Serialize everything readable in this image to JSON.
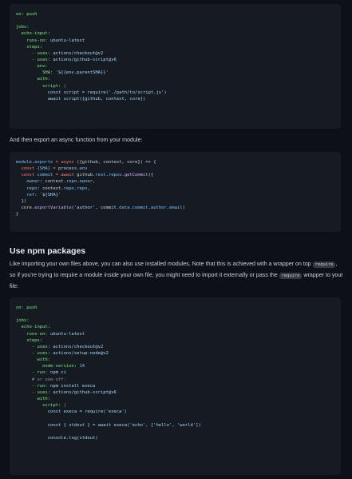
{
  "block1": [
    [
      [
        "on: push",
        "k"
      ]
    ],
    [],
    [
      [
        "jobs:",
        "k"
      ]
    ],
    [
      [
        "  echo-input:",
        "k"
      ]
    ],
    [
      [
        "    runs-on: ",
        "k"
      ],
      [
        "ubuntu-latest",
        "s"
      ]
    ],
    [
      [
        "    steps:",
        "k"
      ]
    ],
    [
      [
        "      - uses: ",
        "k"
      ],
      [
        "actions/checkout@v2",
        "s"
      ]
    ],
    [
      [
        "      - uses: ",
        "k"
      ],
      [
        "actions/github-script@v6",
        "s"
      ]
    ],
    [
      [
        "        env:",
        "k"
      ]
    ],
    [
      [
        "          SHA: ",
        "k"
      ],
      [
        "'${{env.parentSHA}}'",
        "s"
      ]
    ],
    [
      [
        "        with:",
        "k"
      ]
    ],
    [
      [
        "          script: ",
        "k"
      ],
      [
        "|",
        "r"
      ]
    ],
    [
      [
        "            const script = require('./path/to/script.js')",
        "s"
      ]
    ],
    [
      [
        "            await script({github, context, core})",
        "s"
      ]
    ]
  ],
  "para1": "And then export an async function from your module:",
  "block2": [
    [
      [
        "module",
        "v"
      ],
      [
        ".",
        "p"
      ],
      [
        "exports",
        "v"
      ],
      [
        " = ",
        "r"
      ],
      [
        "async",
        "r"
      ],
      [
        " ({github, context, core}) => {",
        "p"
      ]
    ],
    [
      [
        "  ",
        "p"
      ],
      [
        "const",
        "r"
      ],
      [
        " {SHA} ",
        "v"
      ],
      [
        "= ",
        "r"
      ],
      [
        "process",
        "p"
      ],
      [
        ".",
        "p"
      ],
      [
        "env",
        "v"
      ]
    ],
    [
      [
        "  ",
        "p"
      ],
      [
        "const",
        "r"
      ],
      [
        " commit ",
        "v"
      ],
      [
        "= ",
        "r"
      ],
      [
        "await",
        "r"
      ],
      [
        " github.",
        "p"
      ],
      [
        "rest",
        "v"
      ],
      [
        ".",
        "p"
      ],
      [
        "repos",
        "v"
      ],
      [
        ".",
        "p"
      ],
      [
        "getCommit",
        "f"
      ],
      [
        "({",
        "p"
      ]
    ],
    [
      [
        "    owner",
        "v"
      ],
      [
        ": context.",
        "p"
      ],
      [
        "repo",
        "v"
      ],
      [
        ".",
        "p"
      ],
      [
        "owner",
        "v"
      ],
      [
        ",",
        "p"
      ]
    ],
    [
      [
        "    repo",
        "v"
      ],
      [
        ": context.",
        "p"
      ],
      [
        "repo",
        "v"
      ],
      [
        ".",
        "p"
      ],
      [
        "repo",
        "v"
      ],
      [
        ",",
        "p"
      ]
    ],
    [
      [
        "    ref",
        "v"
      ],
      [
        ": ",
        "p"
      ],
      [
        "`${SHA}`",
        "s"
      ]
    ],
    [
      [
        "  })",
        "p"
      ]
    ],
    [
      [
        "  core.",
        "p"
      ],
      [
        "exportVariable",
        "f"
      ],
      [
        "(",
        "p"
      ],
      [
        "'author'",
        "s"
      ],
      [
        ", commit.",
        "p"
      ],
      [
        "data",
        "v"
      ],
      [
        ".",
        "p"
      ],
      [
        "commit",
        "v"
      ],
      [
        ".",
        "p"
      ],
      [
        "author",
        "v"
      ],
      [
        ".",
        "p"
      ],
      [
        "email",
        "v"
      ],
      [
        ")",
        "p"
      ]
    ],
    [
      [
        "}",
        "p"
      ]
    ]
  ],
  "heading": "Use npm packages",
  "para2": {
    "a": "Like importing your own files above, you can also use installed modules. Note that this is achieved with a wrapper on top ",
    "code1": "require",
    "b": ", so if you're trying to require a module inside your own file, you might need to import it externally or pass the ",
    "code2": "require",
    "c": " wrapper to your file:"
  },
  "block3": [
    [
      [
        "on: push",
        "k"
      ]
    ],
    [],
    [
      [
        "jobs:",
        "k"
      ]
    ],
    [
      [
        "  echo-input:",
        "k"
      ]
    ],
    [
      [
        "    runs-on: ",
        "k"
      ],
      [
        "ubuntu-latest",
        "s"
      ]
    ],
    [
      [
        "    steps:",
        "k"
      ]
    ],
    [
      [
        "      - uses: ",
        "k"
      ],
      [
        "actions/checkout@v2",
        "s"
      ]
    ],
    [
      [
        "      - uses: ",
        "k"
      ],
      [
        "actions/setup-node@v2",
        "s"
      ]
    ],
    [
      [
        "        with:",
        "k"
      ]
    ],
    [
      [
        "          node-version: ",
        "k"
      ],
      [
        "14",
        "n"
      ]
    ],
    [
      [
        "      - run: ",
        "k"
      ],
      [
        "npm ci",
        "s"
      ]
    ],
    [
      [
        "      # or one-off:",
        "c"
      ]
    ],
    [
      [
        "      - run: ",
        "k"
      ],
      [
        "npm install execa",
        "s"
      ]
    ],
    [
      [
        "      - uses: ",
        "k"
      ],
      [
        "actions/github-script@v6",
        "s"
      ]
    ],
    [
      [
        "        with:",
        "k"
      ]
    ],
    [
      [
        "          script: ",
        "k"
      ],
      [
        "|",
        "r"
      ]
    ],
    [
      [
        "            const execa = require('execa')",
        "s"
      ]
    ],
    [],
    [
      [
        "            const { stdout } = await execa('echo', ['hello', 'world'])",
        "s"
      ]
    ],
    [],
    [
      [
        "            console.log(stdout)",
        "s"
      ]
    ]
  ]
}
